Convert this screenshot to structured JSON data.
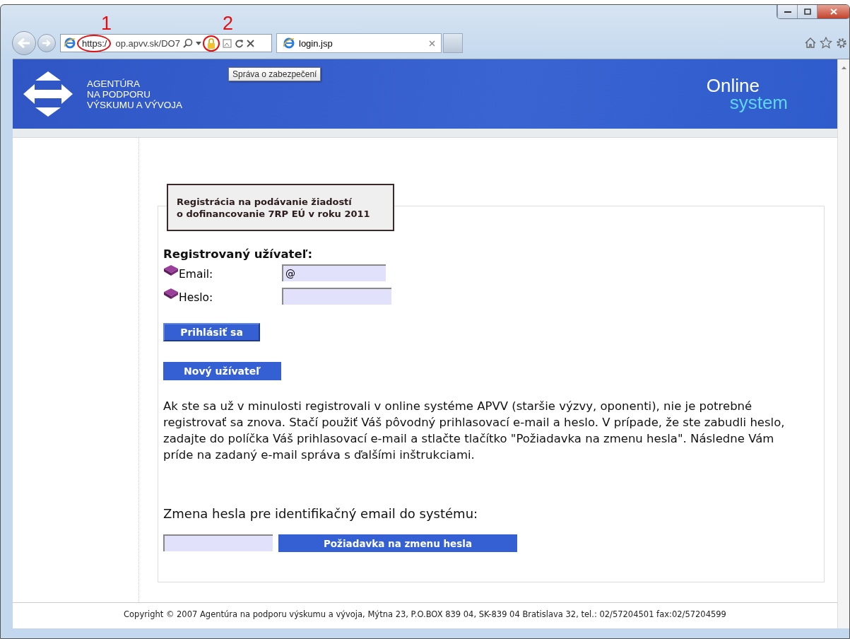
{
  "browser": {
    "address": {
      "scheme": "https:/",
      "rest": "op.apvv.sk/DO7"
    },
    "tab": {
      "label": "login.jsp",
      "selected": true
    },
    "tooltip": "Správa o zabezpečení"
  },
  "annotations": [
    {
      "label": "1"
    },
    {
      "label": "2"
    }
  ],
  "header": {
    "logo_lines": [
      "AGENTÚRA",
      "NA PODPORU",
      "VÝSKUMU A VÝVOJA"
    ],
    "brand": [
      "Online",
      "system"
    ]
  },
  "title_box": [
    "Registrácia na podávanie žiadostí",
    "o dofinancovanie 7RP EÚ v roku 2011"
  ],
  "login": {
    "heading": "Registrovaný užívateľ:",
    "fields": [
      {
        "label": "Email:",
        "value": "@"
      },
      {
        "label": "Heslo:"
      }
    ],
    "login_button": "Prihlásiť sa",
    "new_user_button": "Nový užívateľ"
  },
  "info": "Ak ste sa už v minulosti registrovali v online systéme APVV (staršie výzvy, oponenti), nie je potrebné registrovať sa znova. Stačí použiť Váš pôvodný prihlasovací e-mail a heslo. V prípade, že ste zabudli heslo, zadajte do políčka Váš prihlasovací e-mail a stlačte tlačítko \"Požiadavka na zmenu hesla\". Následne Vám príde na zadaný e-mail správa s ďalšími inštrukciami.",
  "reset": {
    "heading": "Zmena hesla pre identifikačný email do systému:",
    "button": "Požiadavka na zmenu hesla"
  },
  "footer": "Copyright © 2007 Agentúra na podporu výskumu a vývoja, Mýtna 23, P.O.BOX 839 04, SK-839 04 Bratislava 32, tel.: 02/57204501 fax:02/57204599"
}
